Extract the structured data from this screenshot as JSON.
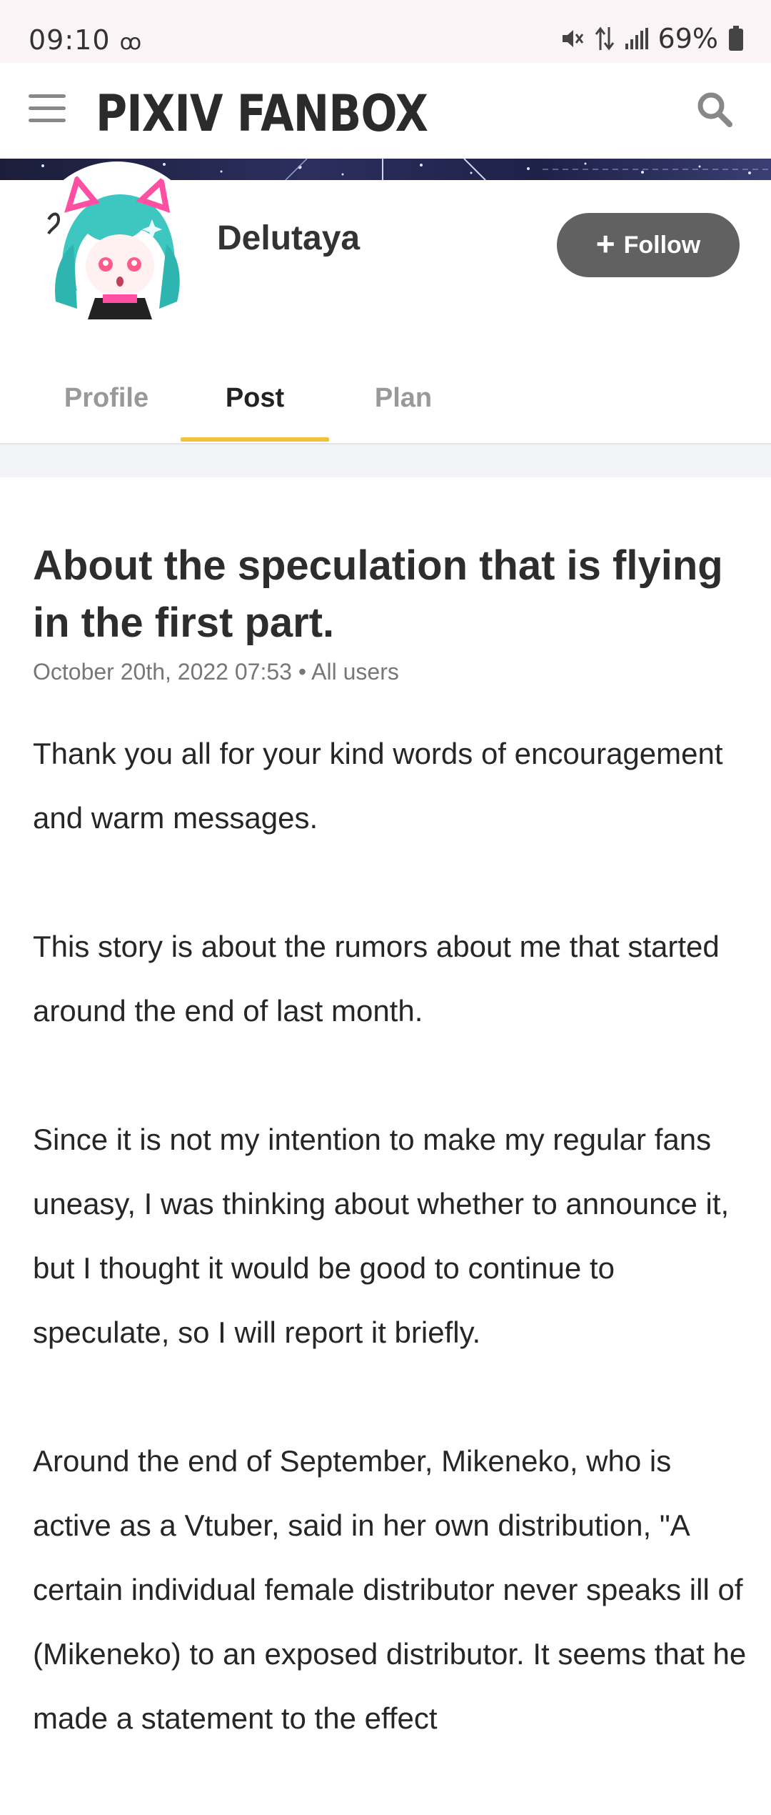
{
  "status_bar": {
    "time": "09:10",
    "battery": "69%",
    "icons": [
      "voicemail-icon",
      "mute-icon",
      "data-transfer-icon",
      "signal-icon",
      "battery-icon"
    ]
  },
  "header": {
    "logo": "PIXIV FANBOX",
    "icons": [
      "menu-icon",
      "search-icon"
    ]
  },
  "creator": {
    "name": "Delutaya",
    "follow_label": "Follow"
  },
  "tabs": [
    {
      "label": "Profile",
      "active": false
    },
    {
      "label": "Post",
      "active": true
    },
    {
      "label": "Plan",
      "active": false
    }
  ],
  "colors": {
    "accent_tab": "#f0c23a",
    "follow_button": "#616161",
    "status_bg": "#fbf4f6"
  },
  "post": {
    "title": "About the speculation that is flying in the first part.",
    "date": "October 20th, 2022 07:53",
    "audience": "All users",
    "paragraphs": [
      "Thank you all for your kind words of encouragement and warm messages.",
      "This story is about the rumors about me that started around the end of last month.",
      "Since it is not my intention to make my regular fans uneasy, I was thinking about whether to announce it, but I thought it would be good to continue to speculate, so I will report it briefly.",
      "Around the end of September, Mikeneko, who is active as a Vtuber, said in her own distribution, \"A certain individual female distributor never speaks ill of (Mikeneko) to an exposed distributor. It seems that he made a statement to the effect"
    ]
  }
}
